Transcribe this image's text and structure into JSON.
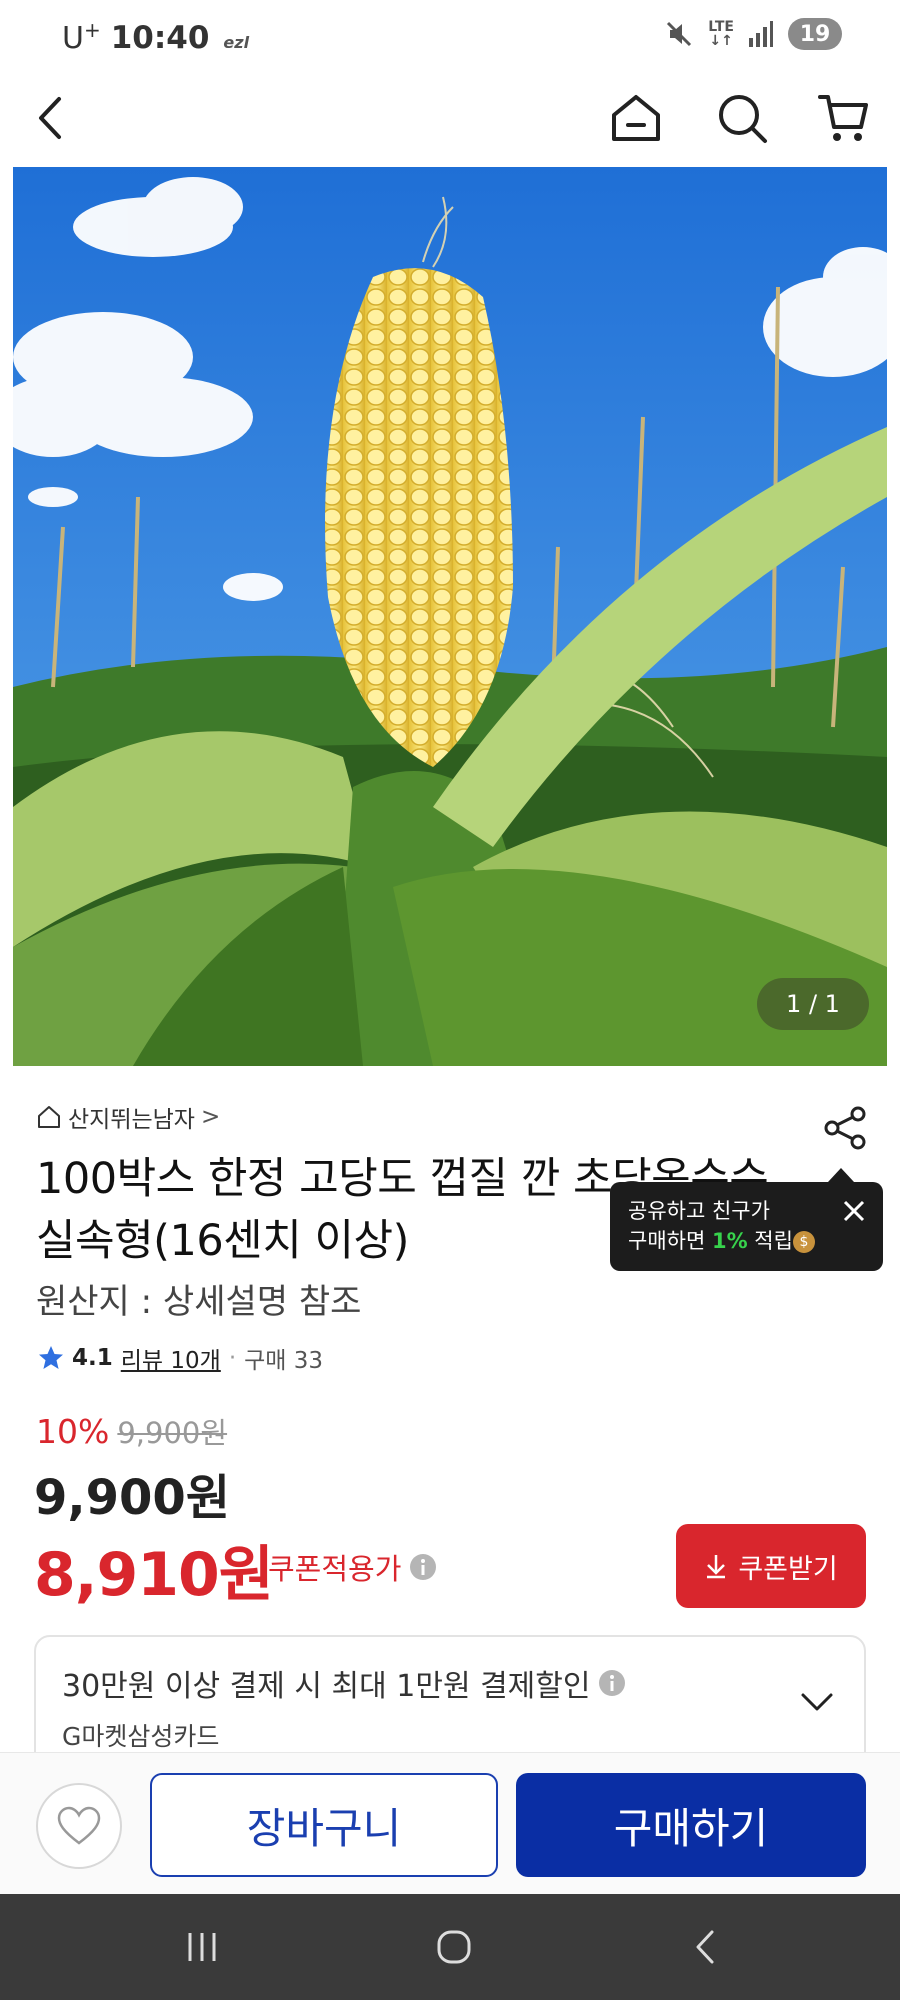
{
  "status_bar": {
    "carrier": "U",
    "carrier_sup": "+",
    "time": "10:40",
    "ezl_label": "ezl",
    "network": "LTE",
    "battery": "19",
    "icons": [
      "mute-icon",
      "signal-icon",
      "battery-icon"
    ]
  },
  "header": {
    "icons": [
      "back-icon",
      "home-icon",
      "search-icon",
      "cart-icon"
    ]
  },
  "gallery": {
    "counter": "1 / 1"
  },
  "product": {
    "seller": "산지뛰는남자",
    "seller_chevron": ">",
    "title": "100박스 한정 고당도 껍질 깐 초당옥수수 실속형(16센치 이상)",
    "origin": "원산지 : 상세설명 참조",
    "rating": "4.1",
    "reviews": "리뷰 10개",
    "separator": "·",
    "purchases": "구매 33"
  },
  "share_tooltip": {
    "line1": "공유하고 친구가",
    "line2_pre": "구매하면 ",
    "line2_rate": "1%",
    "line2_post": " 적립",
    "coin_glyph": "$"
  },
  "price": {
    "discount_rate": "10%",
    "original": "9,900원",
    "sale": "9,900원",
    "coupon_price": "8,910원",
    "coupon_label": "쿠폰적용가",
    "coupon_button": "쿠폰받기"
  },
  "card_offer": {
    "title": "30만원 이상 결제 시 최대 1만원 결제할인",
    "card_name": "G마켓삼성카드"
  },
  "actions": {
    "cart": "장바구니",
    "buy": "구매하기"
  },
  "colors": {
    "accent_red": "#d9262d",
    "brand_blue": "#0a2ea4",
    "tooltip_green": "#37d24c"
  }
}
